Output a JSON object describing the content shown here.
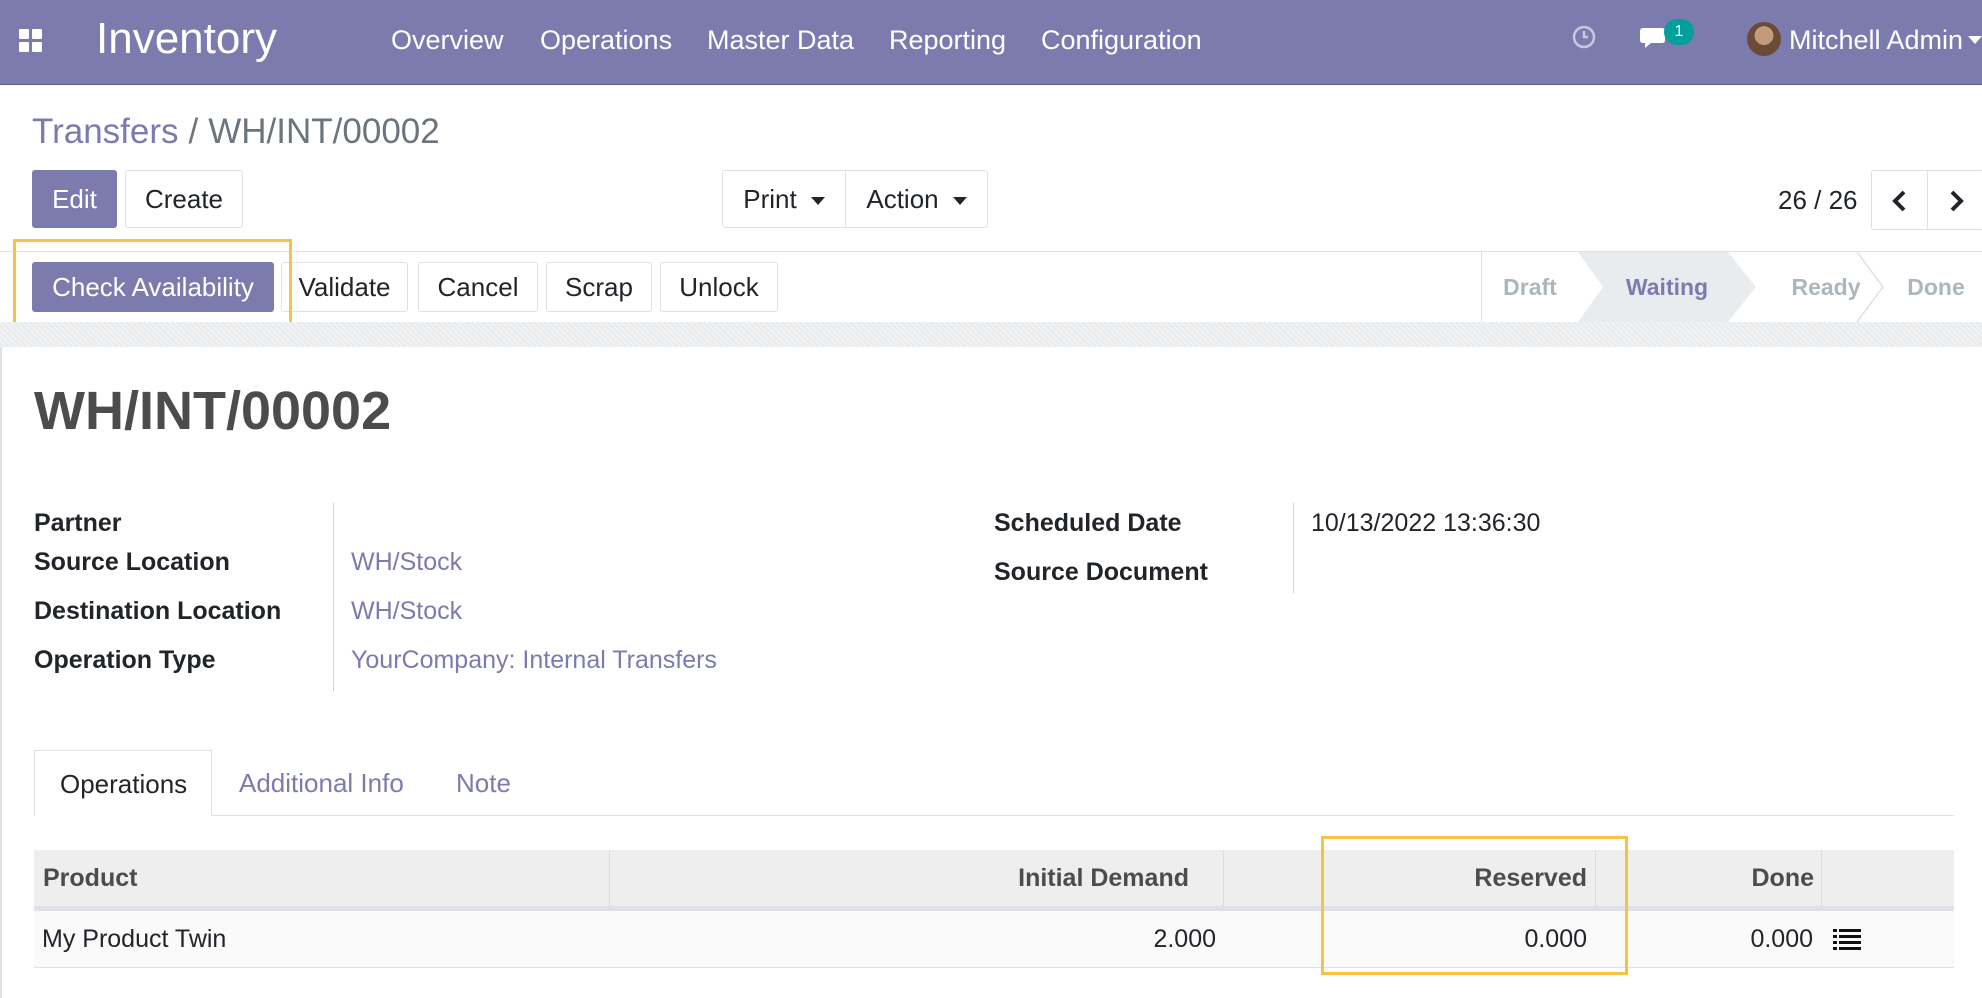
{
  "navbar": {
    "app_name": "Inventory",
    "menu": [
      "Overview",
      "Operations",
      "Master Data",
      "Reporting",
      "Configuration"
    ],
    "chat_badge": "1",
    "user": "Mitchell Admin",
    "icons": [
      "apps-icon",
      "clock-icon",
      "chat-icon",
      "avatar",
      "caret-down-icon"
    ]
  },
  "breadcrumb": {
    "parent": "Transfers",
    "separator": "/",
    "current": "WH/INT/00002"
  },
  "control": {
    "edit": "Edit",
    "create": "Create",
    "print": "Print",
    "action": "Action",
    "pager": "26 / 26"
  },
  "statusbar": {
    "buttons": [
      "Check Availability",
      "Validate",
      "Cancel",
      "Scrap",
      "Unlock"
    ],
    "stages": [
      "Draft",
      "Waiting",
      "Ready",
      "Done"
    ],
    "active_stage": "Waiting"
  },
  "record": {
    "title": "WH/INT/00002",
    "left_fields": [
      {
        "label": "Partner",
        "value": ""
      },
      {
        "label": "Source Location",
        "value": "WH/Stock"
      },
      {
        "label": "Destination Location",
        "value": "WH/Stock"
      },
      {
        "label": "Operation Type",
        "value": "YourCompany: Internal Transfers"
      }
    ],
    "right_fields": [
      {
        "label": "Scheduled Date",
        "value": "10/13/2022 13:36:30"
      },
      {
        "label": "Source Document",
        "value": ""
      }
    ]
  },
  "tabs": [
    "Operations",
    "Additional Info",
    "Note"
  ],
  "table": {
    "headers": [
      "Product",
      "Initial Demand",
      "Reserved",
      "Done"
    ],
    "rows": [
      {
        "product": "My Product Twin",
        "initial_demand": "2.000",
        "reserved": "0.000",
        "done": "0.000"
      }
    ]
  },
  "colors": {
    "brand": "#7c7bad",
    "highlight": "#f5c242",
    "badge": "#00a09d"
  }
}
